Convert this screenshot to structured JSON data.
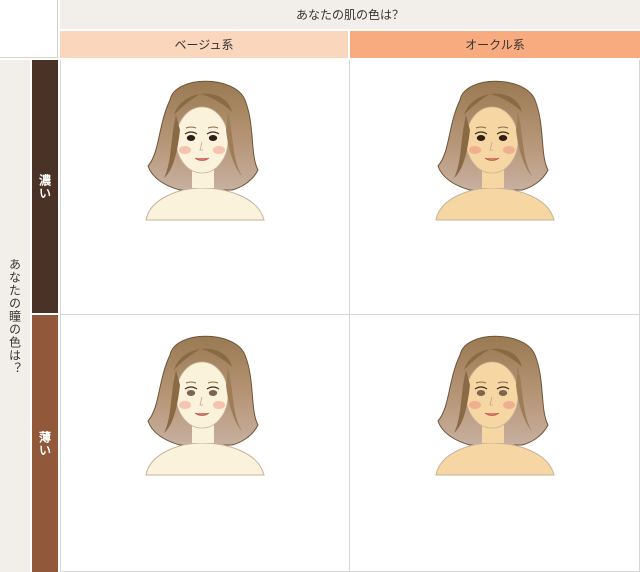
{
  "header": {
    "skin_question": "あなたの肌の色は？",
    "columns": [
      {
        "label": "ベージュ系",
        "color": "#f9d6bc"
      },
      {
        "label": "オークル系",
        "color": "#f7ab7f"
      }
    ]
  },
  "side": {
    "eye_question": "あなたの瞳の色は？",
    "rows": [
      {
        "label": "濃い",
        "color": "#4a3326"
      },
      {
        "label": "薄い",
        "color": "#91593a"
      }
    ]
  },
  "illustrations": [
    {
      "skin": "#fbf2dc",
      "eye": "#2d1e16",
      "cheek": "#f4b7a4"
    },
    {
      "skin": "#f6d7a3",
      "eye": "#2d1e16",
      "cheek": "#eea58b"
    },
    {
      "skin": "#fbf2dc",
      "eye": "#7d6450",
      "cheek": "#f4b7a4"
    },
    {
      "skin": "#f6d7a3",
      "eye": "#7d6450",
      "cheek": "#eea58b"
    }
  ]
}
